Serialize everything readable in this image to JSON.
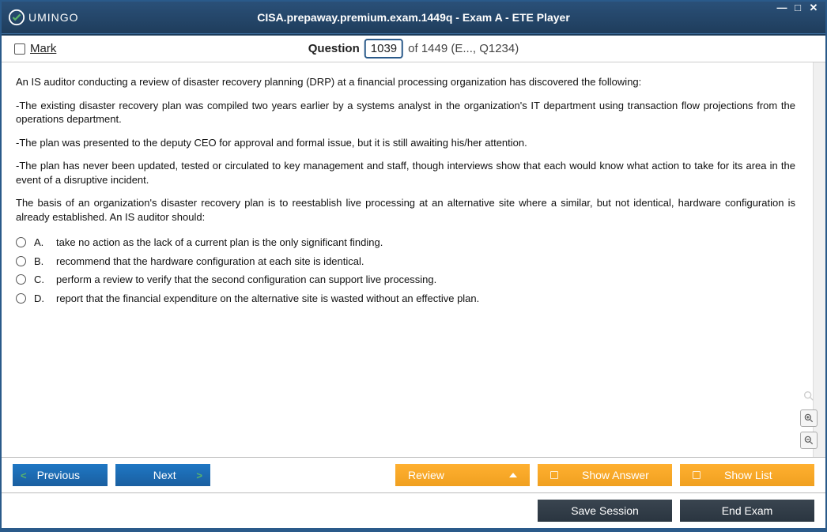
{
  "window": {
    "title": "CISA.prepaway.premium.exam.1449q - Exam A - ETE Player",
    "logo_text": "UMINGO"
  },
  "header": {
    "mark_label": "Mark",
    "question_word": "Question",
    "question_number": "1039",
    "question_total": "of 1449 (E..., Q1234)"
  },
  "question": {
    "intro": "An IS auditor conducting a review of disaster recovery planning (DRP) at a financial processing organization has discovered the following:",
    "p1": "-The existing disaster recovery plan was compiled two years earlier by a systems analyst in the organization's IT department using transaction flow projections from the operations department.",
    "p2": "-The plan was presented to the deputy CEO for approval and formal issue, but it is still awaiting his/her attention.",
    "p3": "-The plan has never been updated, tested or circulated to key management and staff, though interviews show that each would know what action to take for its area in the event of a disruptive incident.",
    "p4": "The basis of an organization's disaster recovery plan is to reestablish live processing at an alternative site where a similar, but not identical, hardware configuration is already established. An IS auditor should:",
    "options": [
      {
        "letter": "A.",
        "text": "take no action as the lack of a current plan is the only significant finding."
      },
      {
        "letter": "B.",
        "text": "recommend that the hardware configuration at each site is identical."
      },
      {
        "letter": "C.",
        "text": "perform a review to verify that the second configuration can support live processing."
      },
      {
        "letter": "D.",
        "text": "report that the financial expenditure on the alternative site is wasted without an effective plan."
      }
    ]
  },
  "buttons": {
    "previous": "Previous",
    "next": "Next",
    "review": "Review",
    "show_answer": "Show Answer",
    "show_list": "Show List",
    "save_session": "Save Session",
    "end_exam": "End Exam"
  }
}
